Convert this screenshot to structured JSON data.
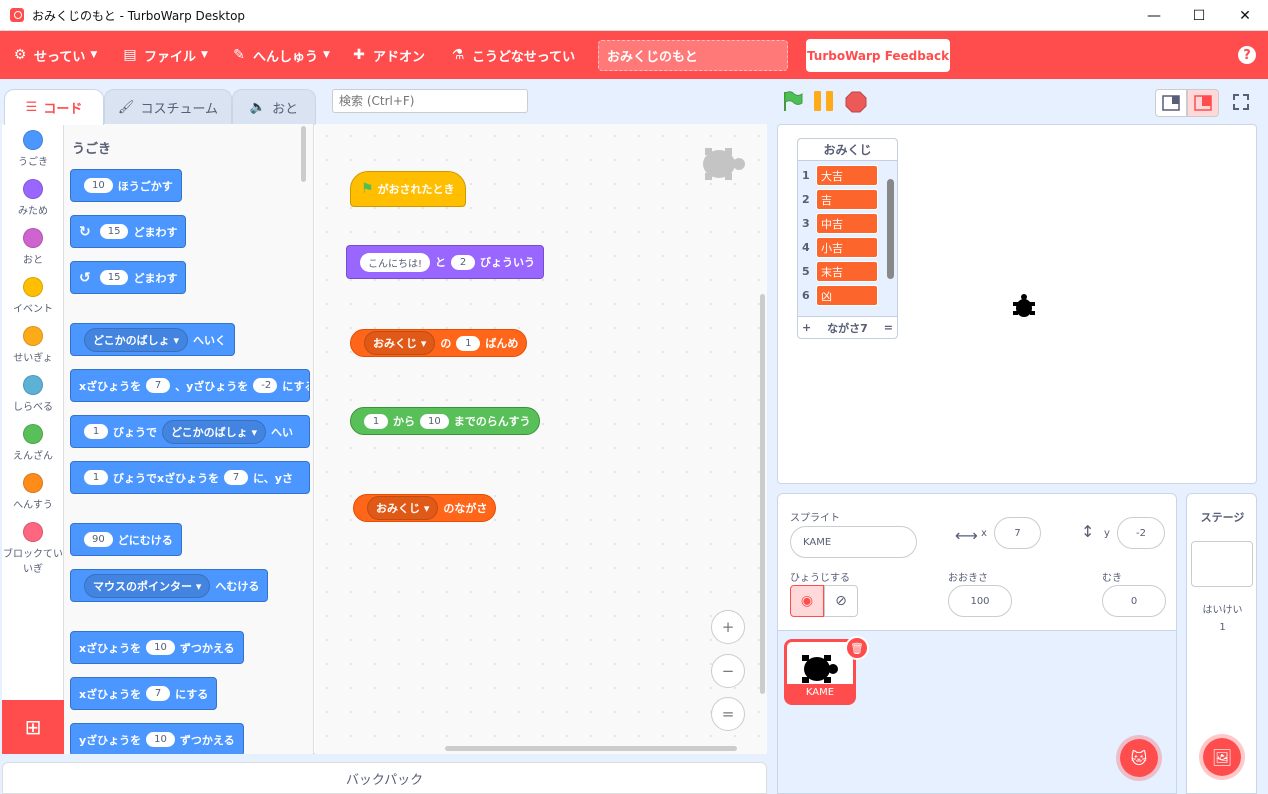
{
  "window": {
    "title": "おみくじのもと - TurboWarp Desktop",
    "minimize": "—",
    "maximize": "☐",
    "close": "✕"
  },
  "menu": {
    "settings": "せってい",
    "file": "ファイル",
    "edit": "へんしゅう",
    "addons": "アドオン",
    "advanced": "こうどなせってい",
    "project_title": "おみくじのもと",
    "feedback": "TurboWarp Feedback",
    "help": "?"
  },
  "tabs": {
    "code": "コード",
    "costumes": "コスチューム",
    "sounds": "おと"
  },
  "search": {
    "placeholder": "検索 (Ctrl+F)"
  },
  "categories": [
    {
      "label": "うごき",
      "color": "#4c97ff"
    },
    {
      "label": "みため",
      "color": "#9966ff"
    },
    {
      "label": "おと",
      "color": "#cf63cf"
    },
    {
      "label": "イベント",
      "color": "#ffbf00"
    },
    {
      "label": "せいぎょ",
      "color": "#ffab19"
    },
    {
      "label": "しらべる",
      "color": "#5cb1d6"
    },
    {
      "label": "えんざん",
      "color": "#59c059"
    },
    {
      "label": "へんすう",
      "color": "#ff8c1a"
    },
    {
      "label": "ブロックてい",
      "label2": "いぎ",
      "color": "#ff6680"
    }
  ],
  "palette": {
    "section": "うごき",
    "move_steps": {
      "value": "10",
      "text": "ほうごかす"
    },
    "turn_right": {
      "value": "15",
      "text": "どまわす"
    },
    "turn_left": {
      "value": "15",
      "text": "どまわす"
    },
    "goto": {
      "drop": "どこかのばしょ",
      "text": "へいく"
    },
    "goto_xy": {
      "t1": "xざひょうを",
      "x": "7",
      "t2": "、yざひょうを",
      "y": "-2",
      "t3": "にする"
    },
    "glide_to": {
      "secs": "1",
      "t1": "びょうで",
      "drop": "どこかのばしょ",
      "t2": "へい"
    },
    "glide_xy": {
      "secs": "1",
      "t1": "びょうでxざひょうを",
      "x": "7",
      "t2": "に、yさ"
    },
    "point_dir": {
      "value": "90",
      "text": "どにむける"
    },
    "point_towards": {
      "drop": "マウスのポインター",
      "text": "へむける"
    },
    "change_x": {
      "t1": "xざひょうを",
      "value": "10",
      "t2": "ずつかえる"
    },
    "set_x": {
      "t1": "xざひょうを",
      "value": "7",
      "t2": "にする"
    },
    "change_y": {
      "t1": "yざひょうを",
      "value": "10",
      "t2": "ずつかえる"
    }
  },
  "scripts": {
    "flag_hat": "がおされたとき",
    "say": {
      "msg": "こんにちは!",
      "t1": "と",
      "secs": "2",
      "t2": "びょういう"
    },
    "item_of": {
      "list": "おみくじ",
      "t1": "の",
      "index": "1",
      "t2": "ばんめ"
    },
    "random": {
      "from": "1",
      "t1": "から",
      "to": "10",
      "t2": "までのらんすう"
    },
    "length": {
      "list": "おみくじ",
      "t1": "のながさ"
    },
    "zoom_in": "+",
    "zoom_out": "−",
    "zoom_reset": "="
  },
  "backpack": "バックパック",
  "list_monitor": {
    "title": "おみくじ",
    "items": [
      {
        "i": "1",
        "v": "大吉"
      },
      {
        "i": "2",
        "v": "吉"
      },
      {
        "i": "3",
        "v": "中吉"
      },
      {
        "i": "4",
        "v": "小吉"
      },
      {
        "i": "5",
        "v": "末吉"
      },
      {
        "i": "6",
        "v": "凶"
      }
    ],
    "add": "+",
    "length": "ながさ7",
    "resize": "="
  },
  "sprite_info": {
    "sprite_label": "スプライト",
    "sprite_name": "KAME",
    "x_label": "x",
    "x_value": "7",
    "y_label": "y",
    "y_value": "-2",
    "show_label": "ひょうじする",
    "size_label": "おおきさ",
    "size_value": "100",
    "dir_label": "むき",
    "dir_value": "0"
  },
  "sprite_tile": {
    "name": "KAME"
  },
  "stage_pane": {
    "title": "ステージ",
    "backdrops_label": "はいけい",
    "backdrops_count": "1"
  },
  "colors": {
    "accent": "#ff4c4c",
    "motion": "#4c97ff",
    "looks": "#9966ff",
    "list": "#ff661a",
    "operators": "#59c059",
    "events": "#ffbf00"
  }
}
